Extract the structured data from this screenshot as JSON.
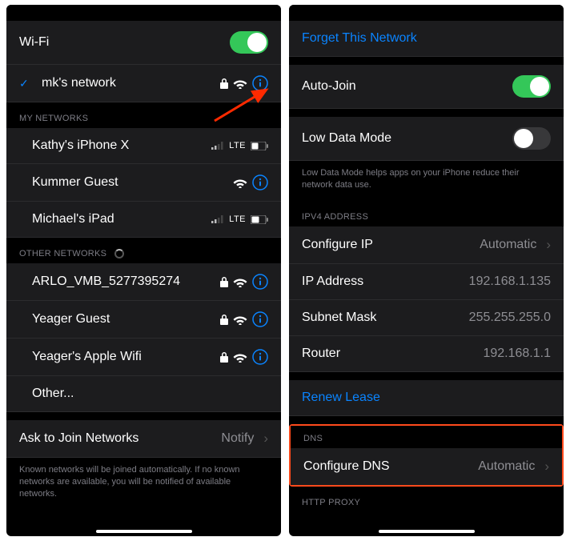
{
  "left": {
    "wifi_label": "Wi-Fi",
    "wifi_on": true,
    "connected": {
      "name": "mk's network"
    },
    "my_networks_header": "My Networks",
    "my_networks": [
      {
        "name": "Kathy's iPhone X",
        "lte": true
      },
      {
        "name": "Kummer Guest",
        "lte": false
      },
      {
        "name": "Michael's iPad",
        "lte": true
      }
    ],
    "other_header": "Other Networks",
    "other_networks": [
      {
        "name": "ARLO_VMB_5277395274"
      },
      {
        "name": "Yeager Guest"
      },
      {
        "name": "Yeager's Apple Wifi"
      }
    ],
    "other_label": "Other...",
    "ask_label": "Ask to Join Networks",
    "ask_value": "Notify",
    "ask_footer": "Known networks will be joined automatically. If no known networks are available, you will be notified of available networks."
  },
  "right": {
    "forget_label": "Forget This Network",
    "autojoin_label": "Auto-Join",
    "autojoin_on": true,
    "lowdata_label": "Low Data Mode",
    "lowdata_on": false,
    "lowdata_footer": "Low Data Mode helps apps on your iPhone reduce their network data use.",
    "ipv4_header": "IPV4 Address",
    "configure_ip_label": "Configure IP",
    "configure_ip_value": "Automatic",
    "ip_label": "IP Address",
    "ip_value": "192.168.1.135",
    "subnet_label": "Subnet Mask",
    "subnet_value": "255.255.255.0",
    "router_label": "Router",
    "router_value": "192.168.1.1",
    "renew_label": "Renew Lease",
    "dns_header": "DNS",
    "configure_dns_label": "Configure DNS",
    "configure_dns_value": "Automatic",
    "httpproxy_header": "HTTP Proxy"
  }
}
